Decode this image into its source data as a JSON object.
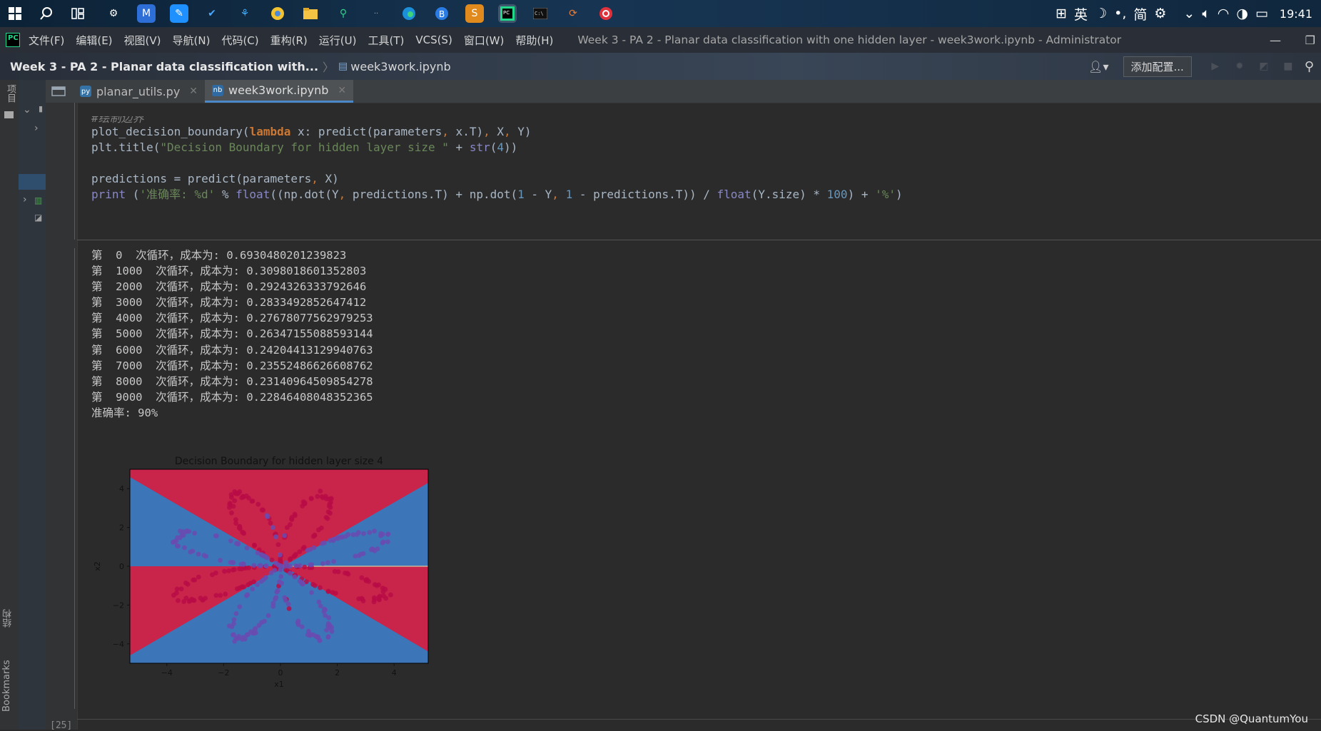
{
  "taskbar": {
    "tray_ime": "英",
    "tray_simplified": "简",
    "clock": "19:41"
  },
  "menubar": {
    "items": [
      "文件(F)",
      "编辑(E)",
      "视图(V)",
      "导航(N)",
      "代码(C)",
      "重构(R)",
      "运行(U)",
      "工具(T)",
      "VCS(S)",
      "窗口(W)",
      "帮助(H)"
    ],
    "window_title": "Week 3 - PA 2 - Planar data classification with one hidden layer - week3work.ipynb - Administrator"
  },
  "navbar": {
    "project": "Week 3 - PA 2 - Planar data classification with...",
    "file": "week3work.ipynb",
    "add_config": "添加配置..."
  },
  "left_stripe": {
    "project_label": "项目",
    "structure_label": "结构",
    "bookmarks_label": "Bookmarks"
  },
  "tabs": [
    {
      "label": "planar_utils.py",
      "active": false
    },
    {
      "label": "week3work.ipynb",
      "active": true
    }
  ],
  "code_lines": [
    "#绘制边界",
    "plot_decision_boundary(lambda x: predict(parameters, x.T), X, Y)",
    "plt.title(\"Decision Boundary for hidden layer size \" + str(4))",
    "",
    "predictions = predict(parameters, X)",
    "print ('准确率: %d' % float((np.dot(Y, predictions.T) + np.dot(1 - Y, 1 - predictions.T)) / float(Y.size) * 100) + '%')"
  ],
  "output_lines": [
    "第  0  次循环，成本为: 0.6930480201239823",
    "第  1000  次循环，成本为: 0.3098018601352803",
    "第  2000  次循环，成本为: 0.2924326333792646",
    "第  3000  次循环，成本为: 0.2833492852647412",
    "第  4000  次循环，成本为: 0.27678077562979253",
    "第  5000  次循环，成本为: 0.26347155088593144",
    "第  6000  次循环，成本为: 0.24204413129940763",
    "第  7000  次循环，成本为: 0.23552486626608762",
    "第  8000  次循环，成本为: 0.23140964509854278",
    "第  9000  次循环，成本为: 0.22846408048352365",
    "准确率: 90%"
  ],
  "chart_data": {
    "type": "scatter",
    "title": "Decision Boundary for hidden layer size 4",
    "xlabel": "x1",
    "ylabel": "x2",
    "xlim": [
      -5.3,
      5.2
    ],
    "ylim": [
      -5.0,
      5.0
    ],
    "xticks": [
      -4,
      -2,
      0,
      2,
      4
    ],
    "yticks": [
      4,
      2,
      0,
      -2,
      -4
    ],
    "region_colors": {
      "class_0": "#c9244a",
      "class_1": "#3c76b8"
    },
    "point_colors": {
      "class_0": "#b80c46",
      "class_1": "#6a4bb0"
    },
    "n_petals": 8
  },
  "gutter": {
    "exec_count": "[25]"
  },
  "watermark": "CSDN @QuantumYou"
}
